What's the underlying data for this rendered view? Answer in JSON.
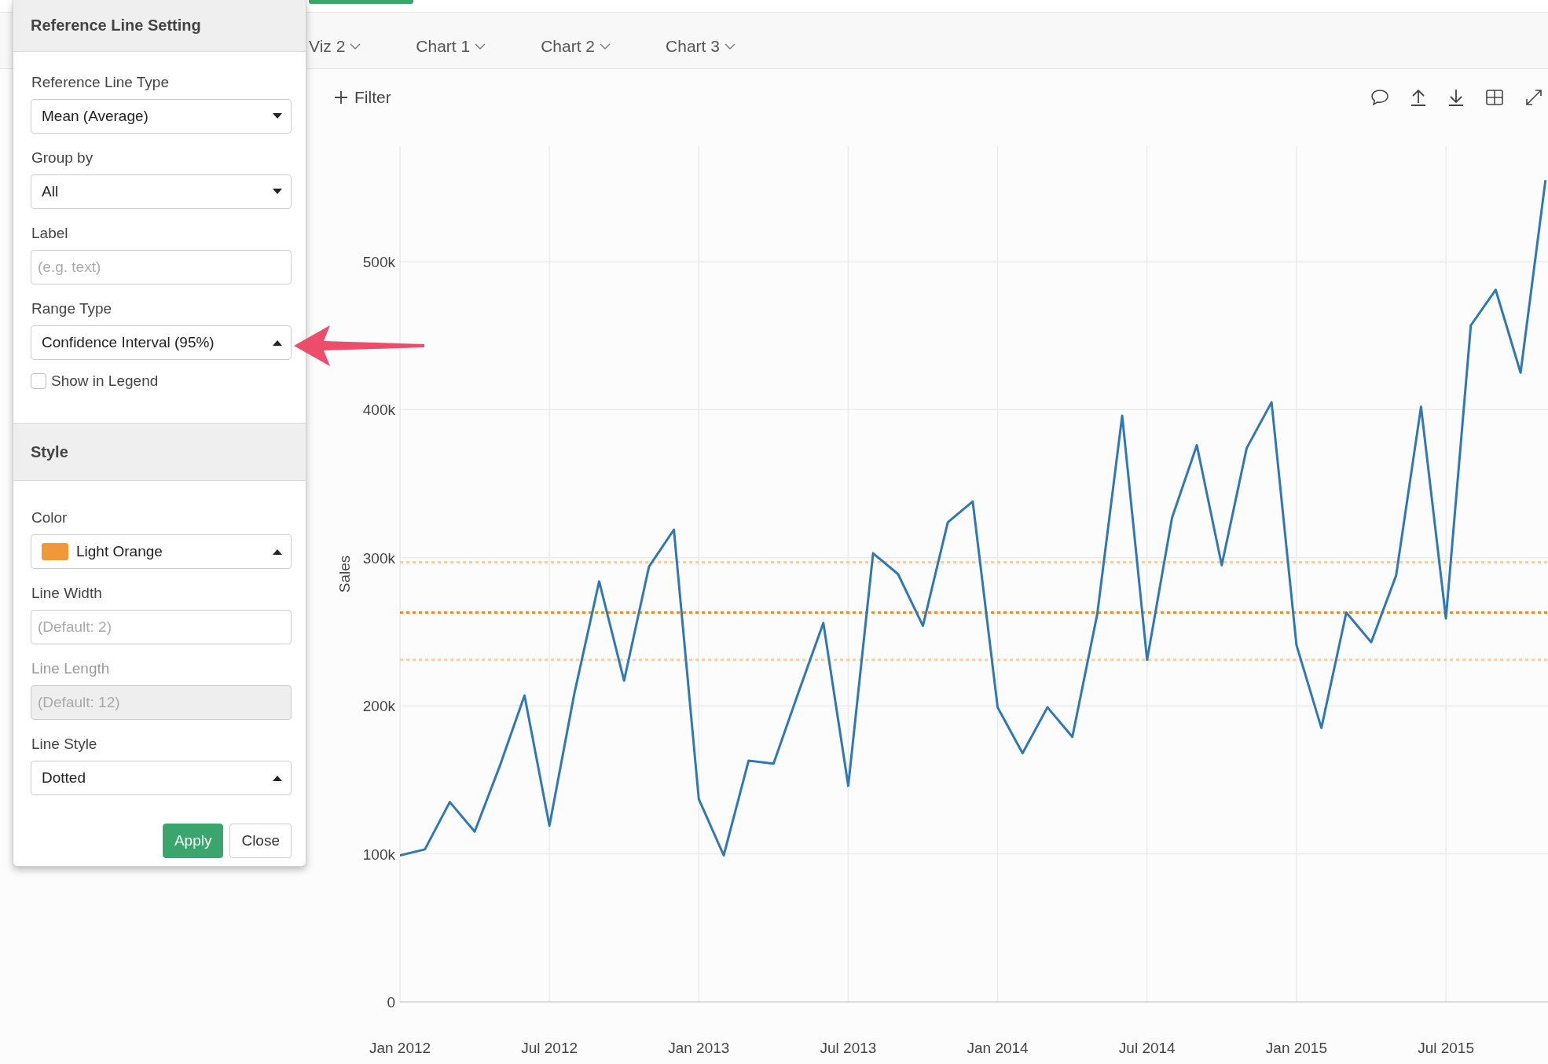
{
  "tabs": [
    {
      "label": "Viz 2"
    },
    {
      "label": "Chart 1"
    },
    {
      "label": "Chart 2"
    },
    {
      "label": "Chart 3"
    }
  ],
  "toolbar": {
    "filter_button": "Filter"
  },
  "chart": {
    "chart_data": {
      "type": "line",
      "ylabel": "Sales",
      "categories": [
        "Jan 2012",
        null,
        null,
        null,
        null,
        null,
        "Jul 2012",
        null,
        null,
        null,
        null,
        null,
        "Jan 2013",
        null,
        null,
        null,
        null,
        null,
        "Jul 2013",
        null,
        null,
        null,
        null,
        null,
        "Jan 2014",
        null,
        null,
        null,
        null,
        null,
        "Jul 2014",
        null,
        null,
        null,
        null,
        null,
        "Jan 2015",
        null,
        null,
        null,
        null,
        null,
        "Jul 2015",
        null,
        null,
        null,
        null
      ],
      "series": [
        {
          "color": "#2f78b4",
          "values": [
            99000,
            103000,
            135000,
            115000,
            159000,
            207000,
            119000,
            208000,
            284000,
            217000,
            294000,
            319000,
            137000,
            99000,
            163000,
            161000,
            209000,
            256000,
            146000,
            303000,
            289000,
            254000,
            324000,
            338000,
            199000,
            168000,
            199000,
            179000,
            262000,
            396000,
            231000,
            327000,
            376000,
            295000,
            374000,
            405000,
            241000,
            185000,
            263000,
            243000,
            288000,
            402000,
            259000,
            457000,
            481000,
            425000,
            555000
          ]
        }
      ],
      "ylim": [
        0,
        578000
      ],
      "grid": true,
      "yticks": [
        {
          "value": 0,
          "label": "0"
        },
        {
          "value": 100000,
          "label": "100k"
        },
        {
          "value": 200000,
          "label": "200k"
        },
        {
          "value": 300000,
          "label": "300k"
        },
        {
          "value": 400000,
          "label": "400k"
        },
        {
          "value": 500000,
          "label": "500k"
        }
      ],
      "ref_lines": [
        {
          "axis": "y",
          "value": 297000,
          "color": "#f9cd9e"
        },
        {
          "axis": "y",
          "value": 263000,
          "color": "#f08a1c"
        },
        {
          "axis": "y",
          "value": 231000,
          "color": "#f9cd9e"
        }
      ]
    }
  },
  "panel": {
    "title": "Reference Line Setting",
    "fields": [
      {
        "kind": "select",
        "label": "Reference Line Type",
        "value": "Mean (Average)",
        "expanded": false
      },
      {
        "kind": "select",
        "label": "Group by",
        "value": "All",
        "expanded": false
      },
      {
        "kind": "text",
        "label": "Label",
        "placeholder": "(e.g. text)",
        "disabled": false
      },
      {
        "kind": "select",
        "label": "Range Type",
        "value": "Confidence Interval (95%)",
        "expanded": true
      },
      {
        "kind": "checkbox",
        "label": "Show in Legend",
        "checked": false
      }
    ],
    "style_section": {
      "title": "Style",
      "fields": [
        {
          "kind": "color",
          "label": "Color",
          "value": "Light Orange",
          "color": "#f0993a",
          "expanded": true
        },
        {
          "kind": "text",
          "label": "Line Width",
          "placeholder": "(Default: 2)",
          "disabled": false
        },
        {
          "kind": "text",
          "label": "Line Length",
          "placeholder": "(Default: 12)",
          "disabled": true
        },
        {
          "kind": "select",
          "label": "Line Style",
          "value": "Dotted",
          "expanded": true
        }
      ]
    },
    "buttons": [
      {
        "label": "Apply",
        "kind": "primary"
      },
      {
        "label": "Close",
        "kind": "default"
      }
    ]
  }
}
